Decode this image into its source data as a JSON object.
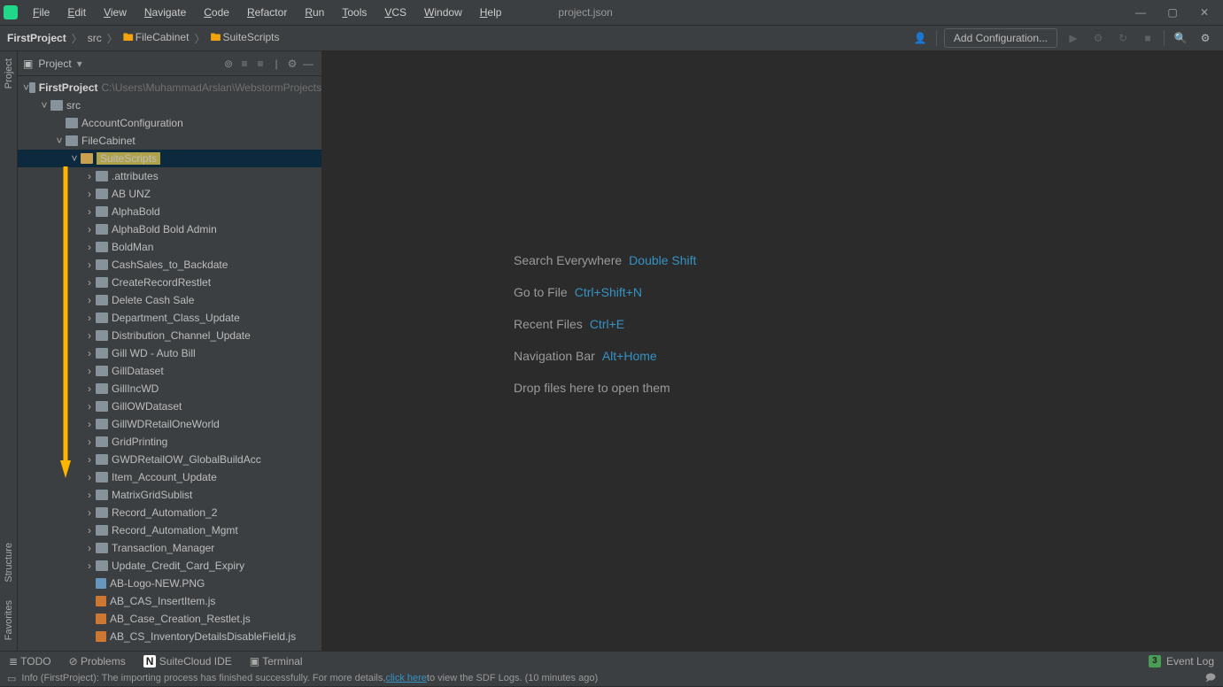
{
  "menu": [
    "File",
    "Edit",
    "View",
    "Navigate",
    "Code",
    "Refactor",
    "Run",
    "Tools",
    "VCS",
    "Window",
    "Help"
  ],
  "titleFile": "project.json",
  "breadcrumb": [
    "FirstProject",
    "src",
    "FileCabinet",
    "SuiteScripts"
  ],
  "addConfig": "Add Configuration...",
  "leftTabs": {
    "project": "Project",
    "structure": "Structure",
    "favorites": "Favorites"
  },
  "panel": {
    "title": "Project"
  },
  "tree": {
    "root": {
      "name": "FirstProject",
      "path": "C:\\Users\\MuhammadArslan\\WebstormProjects"
    },
    "src": "src",
    "accountConfig": "AccountConfiguration",
    "fileCabinet": "FileCabinet",
    "suiteScripts": "SuiteScripts",
    "folders": [
      ".attributes",
      "AB UNZ",
      "AlphaBold",
      "AlphaBold Bold Admin",
      "BoldMan",
      "CashSales_to_Backdate",
      "CreateRecordRestlet",
      "Delete Cash Sale",
      "Department_Class_Update",
      "Distribution_Channel_Update",
      "Gill WD - Auto Bill",
      "GillDataset",
      "GillIncWD",
      "GillOWDataset",
      "GillWDRetailOneWorld",
      "GridPrinting",
      "GWDRetailOW_GlobalBuildAcc",
      "Item_Account_Update",
      "MatrixGridSublist",
      "Record_Automation_2",
      "Record_Automation_Mgmt",
      "Transaction_Manager",
      "Update_Credit_Card_Expiry"
    ],
    "files": [
      {
        "name": "AB-Logo-NEW.PNG",
        "type": "img"
      },
      {
        "name": "AB_CAS_InsertItem.js",
        "type": "js"
      },
      {
        "name": "AB_Case_Creation_Restlet.js",
        "type": "js"
      },
      {
        "name": "AB_CS_InventoryDetailsDisableField.js",
        "type": "js"
      }
    ]
  },
  "welcome": {
    "rows": [
      {
        "label": "Search Everywhere",
        "key": "Double Shift"
      },
      {
        "label": "Go to File",
        "key": "Ctrl+Shift+N"
      },
      {
        "label": "Recent Files",
        "key": "Ctrl+E"
      },
      {
        "label": "Navigation Bar",
        "key": "Alt+Home"
      }
    ],
    "drop": "Drop files here to open them"
  },
  "bottomTools": {
    "todo": "TODO",
    "problems": "Problems",
    "suitecloud": "SuiteCloud IDE",
    "terminal": "Terminal",
    "eventlog": "Event Log",
    "badge": "3"
  },
  "status": {
    "prefix": "Info (FirstProject): The importing process has finished successfully. For more details, ",
    "link": "click here",
    "suffix": " to view the SDF Logs. (10 minutes ago)"
  }
}
